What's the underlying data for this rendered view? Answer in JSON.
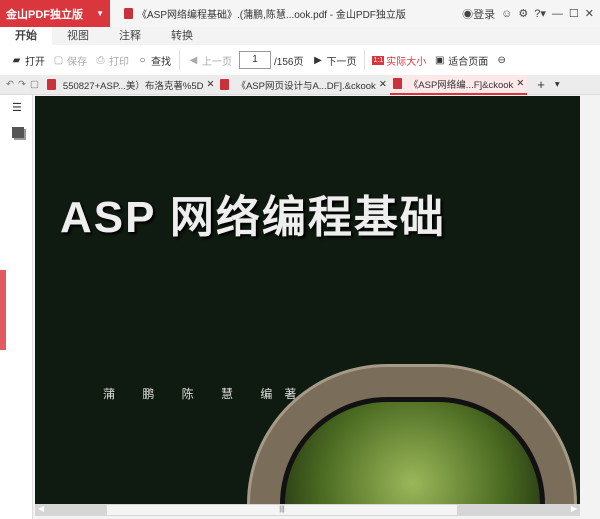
{
  "app": {
    "brand": "金山PDF独立版",
    "window_title": "《ASP网络编程基础》.(蒲鹏,陈慧...ook.pdf - 金山PDF独立版",
    "login": "登录"
  },
  "ribbon_tabs": [
    "开始",
    "视图",
    "注释",
    "转换"
  ],
  "toolbar": {
    "open": "打开",
    "save": "保存",
    "print": "打印",
    "find": "查找",
    "prev": "上一页",
    "page": "1",
    "total": "/156页",
    "next": "下一页",
    "actual_size": "实际大小",
    "fit_page": "适合页面"
  },
  "doc_tabs": [
    "550827+ASP...美）布洛克著%5D",
    "《ASP网页设计与A...DF].&ckook",
    "《ASP网络编...F]&ckook"
  ],
  "cover": {
    "title": "ASP 网络编程基础",
    "authors": "蒲 鹏 陈 慧 编著"
  },
  "colors": {
    "accent": "#d9363e"
  }
}
